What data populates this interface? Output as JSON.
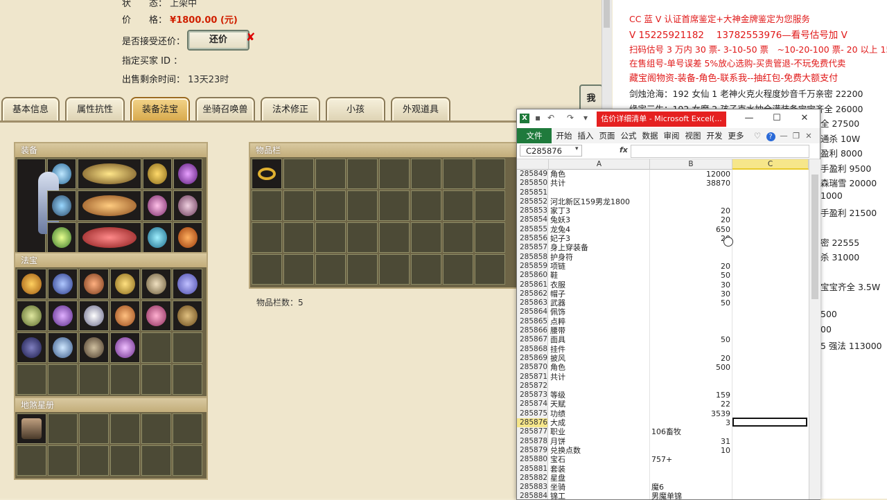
{
  "game": {
    "status_label": "状　　态：",
    "status_value": "上架中",
    "price_label": "价　　格：",
    "price_value": "¥1800.00 (元)",
    "counter_label": "是否接受还价：",
    "counter_button": "还价",
    "counter_mark": "✘",
    "buyer_label": "指定买家 ID ：",
    "remaining_label": "出售剩余时间：",
    "remaining_value": "13天23时",
    "side_button": "我",
    "tabs": [
      "基本信息",
      "属性抗性",
      "装备法宝",
      "坐骑召唤兽",
      "法术修正",
      "小孩",
      "外观道具"
    ],
    "active_tab": "装备法宝",
    "panels": {
      "equipment": "装备",
      "treasure": "法宝",
      "star_book": "地煞星册",
      "inventory": "物品栏"
    },
    "inventory_count_label": "物品栏数：5"
  },
  "doc": {
    "lines": [
      {
        "text": "CC 蓝 V 认证首席鉴定+大神金牌鉴定为您服务",
        "color": "red"
      },
      {
        "text": "V 15225921182　 13782553976—看号估号加 V",
        "color": "red"
      },
      {
        "text": "扫码估号 3 万内 30 票- 3-10-50 票　~10-20-100 票- 20 以上 150",
        "color": "red"
      },
      {
        "text": "在售组号-单号误差 5%放心选购-买贵管退-不玩免费代卖",
        "color": "red"
      },
      {
        "text": "藏宝阁物资-装备-角色-联系我--抽红包-免费大额支付",
        "color": "red"
      },
      {
        "text": "剑烛沧海：192 女仙 1 老神火克火程度妙音千万亲密 22200",
        "color": "dark"
      },
      {
        "text": "缘定三生：192 女魔 2 孩子克水抽全满装备宝宝齐全 26000",
        "color": "dark"
      }
    ],
    "peek": [
      "全 27500",
      "通杀 10W",
      "盈利 8000",
      "手盈利 9500",
      "森瑞雪 20000",
      "1000",
      "手盈利 21500",
      "密 22555",
      "杀 31000",
      "宝宝齐全 3.5W",
      "500",
      "00",
      "5 强法 113000"
    ]
  },
  "excel": {
    "title": "估价详细清单 - Microsoft Excel(...",
    "ribbon_tabs": [
      "文件",
      "开始",
      "插入",
      "页面",
      "公式",
      "数据",
      "审阅",
      "视图",
      "开发",
      "更多"
    ],
    "name_box": "C285876",
    "fx": "fx",
    "columns": [
      "A",
      "B",
      "C"
    ],
    "selected_row": "285876",
    "rows": [
      {
        "n": "285849",
        "a": "角色",
        "b": "12000"
      },
      {
        "n": "285850",
        "a": "共计",
        "b": "38870"
      },
      {
        "n": "285851",
        "a": "",
        "b": ""
      },
      {
        "n": "285852",
        "a": "河北新区159男龙1800",
        "b": ""
      },
      {
        "n": "285853",
        "a": "家丁3",
        "b": "20"
      },
      {
        "n": "285854",
        "a": "兔妖3",
        "b": "20"
      },
      {
        "n": "285855",
        "a": "龙兔4",
        "b": "650"
      },
      {
        "n": "285856",
        "a": "妃子3",
        "b": "20"
      },
      {
        "n": "285857",
        "a": "身上穿装备",
        "b": ""
      },
      {
        "n": "285858",
        "a": "护身符",
        "b": ""
      },
      {
        "n": "285859",
        "a": "项链",
        "b": "20"
      },
      {
        "n": "285860",
        "a": "鞋",
        "b": "50"
      },
      {
        "n": "285861",
        "a": "衣服",
        "b": "30"
      },
      {
        "n": "285862",
        "a": "帽子",
        "b": "30"
      },
      {
        "n": "285863",
        "a": "武器",
        "b": "50"
      },
      {
        "n": "285864",
        "a": "佩饰",
        "b": ""
      },
      {
        "n": "285865",
        "a": "点粹",
        "b": ""
      },
      {
        "n": "285866",
        "a": "腰带",
        "b": ""
      },
      {
        "n": "285867",
        "a": "面具",
        "b": "50"
      },
      {
        "n": "285868",
        "a": "挂件",
        "b": ""
      },
      {
        "n": "285869",
        "a": "披风",
        "b": "20"
      },
      {
        "n": "285870",
        "a": "角色",
        "b": "500"
      },
      {
        "n": "285871",
        "a": "共计",
        "b": ""
      },
      {
        "n": "285872",
        "a": "",
        "b": ""
      },
      {
        "n": "285873",
        "a": "等级",
        "b": "159"
      },
      {
        "n": "285874",
        "a": "天赋",
        "b": "22"
      },
      {
        "n": "285875",
        "a": "功绩",
        "b": "3539"
      },
      {
        "n": "285876",
        "a": "大成",
        "b": "3"
      },
      {
        "n": "285877",
        "a": "职业",
        "bt": "106畜牧"
      },
      {
        "n": "285878",
        "a": "月饼",
        "b": "31"
      },
      {
        "n": "285879",
        "a": "兑换点数",
        "b": "10"
      },
      {
        "n": "285880",
        "a": "宝石",
        "bt": "757+"
      },
      {
        "n": "285881",
        "a": "套装",
        "b": ""
      },
      {
        "n": "285882",
        "a": "星盘",
        "b": ""
      },
      {
        "n": "285883",
        "a": "坐骑",
        "bt": "魔6"
      },
      {
        "n": "285884",
        "a": "锦工",
        "bt": "男魔单锦"
      }
    ]
  }
}
